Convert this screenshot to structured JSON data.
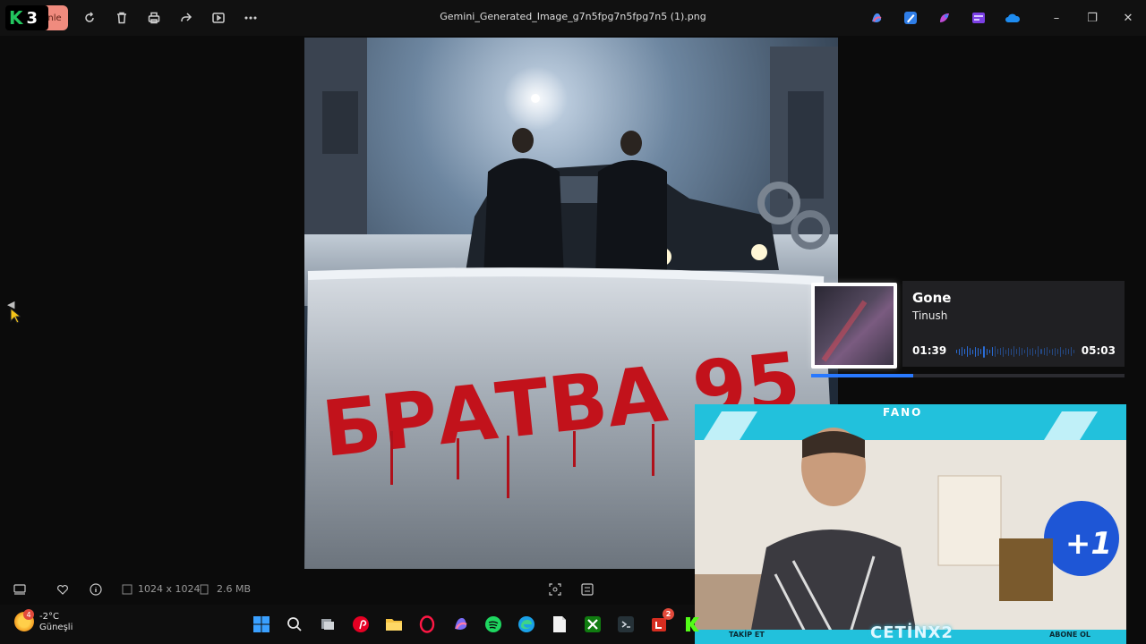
{
  "titlebar": {
    "logo_letter": "K",
    "logo_number": "3",
    "edit_label": "nle",
    "file_name": "Gemini_Generated_Image_g7n5fpg7n5fpg7n5 (1).png",
    "toolbar_icons": [
      "rotate-icon",
      "delete-icon",
      "print-icon",
      "share-icon",
      "slideshow-icon",
      "more-icon"
    ],
    "app_icons": [
      "copilot-icon",
      "paint-icon",
      "designer-icon",
      "clipchamp-icon",
      "onedrive-icon"
    ],
    "window_controls": {
      "minimize": "–",
      "maximize": "❐",
      "close": "✕"
    }
  },
  "image": {
    "graffiti_text": "БРАТВА 95"
  },
  "nav": {
    "prev_arrow": "◀"
  },
  "music": {
    "title": "Gone",
    "artist": "Tinush",
    "current_time": "01:39",
    "total_time": "05:03",
    "progress": 0.327,
    "accent": "#2979ff"
  },
  "webcam": {
    "top_text": "FANO",
    "follow_label": "TAKİP ET",
    "channel_name": "CETİNX2",
    "subscribe_label": "ABONE OL",
    "plus_label": "+1"
  },
  "infobar": {
    "dimensions": "1024 x 1024",
    "file_size": "2.6 MB"
  },
  "taskbar": {
    "weather_badge": "4",
    "temperature": "-2°C",
    "condition": "Güneşli",
    "mail_badge": "2"
  }
}
